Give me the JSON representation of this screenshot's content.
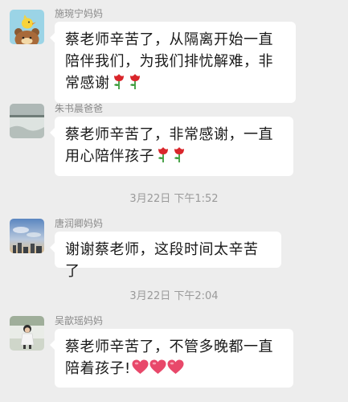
{
  "messages": [
    {
      "sender": "施琬宁妈妈",
      "text": "蔡老师辛苦了，从隔离开始一直陪伴我们，为我们排忧解难，非常感谢",
      "emoji": "rose-emoji",
      "emoji_count": 2
    },
    {
      "sender": "朱书晨爸爸",
      "text": "蔡老师辛苦了，非常感谢，一直用心陪伴孩子",
      "emoji": "rose-emoji",
      "emoji_count": 2
    },
    {
      "sender": "唐润卿妈妈",
      "text": "谢谢蔡老师，这段时间太辛苦了"
    },
    {
      "sender": "吴歆瑶妈妈",
      "text": "蔡老师辛苦了，不管多晚都一直陪着孩子!",
      "emoji": "heart-emoji",
      "emoji_count": 3
    }
  ],
  "timestamps": [
    "3月22日 下午1:52",
    "3月22日 下午2:04"
  ],
  "colors": {
    "background": "#ededed",
    "bubble": "#ffffff",
    "rose": "#d9262b",
    "heart": "#e8486a"
  }
}
